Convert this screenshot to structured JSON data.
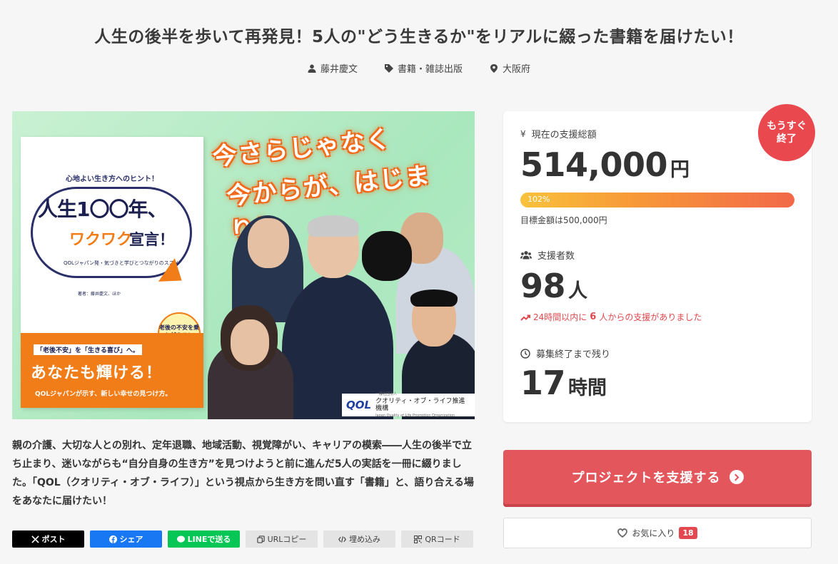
{
  "project": {
    "title": "人生の後半を歩いて再発見！5人の\"どう生きるか\"をリアルに綴った書籍を届けたい！",
    "owner": "藤井慶文",
    "category": "書籍・雑誌出版",
    "location": "大阪府",
    "description": "親の介護、大切な人との別れ、定年退職、地域活動、視覚障がい、キャリアの模索――人生の後半で立ち止まり、迷いながらも“自分自身の生き方”を見つけようと前に進んだ5人の実話を一冊に綴りました。「QOL（クオリティ・オブ・ライフ）」という視点から生き方を問い直す「書籍」と、語り合える場をあなたに届けたい！"
  },
  "hero_image": {
    "catch_line1": "今さらじゃなく",
    "catch_line2": "今からが、はじまり！",
    "book_hint": "心地よい生き方へのヒント！",
    "book_title1": "人生1〇〇年、",
    "book_title2": "ワクワク",
    "book_title3": "宣言！",
    "book_sub": "QOLジャパン発・気づきと学びとつながりのススメ",
    "book_author": "著者：藤井慶文、ほか",
    "book_badge": "老後の不安を乗り越える！",
    "book_band1": "「老後不安」を「生きる喜び」へ。",
    "book_band2": "あなたも輝ける！",
    "book_band3": "QOLジャパンが示す、新しい幸せの見つけ方。",
    "org_logo": "QOL",
    "org_type": "一般社団法人",
    "org_name": "クオリティ・オブ・ライフ推進機構",
    "org_en": "Japan Quality of Life Promotion Organization"
  },
  "stats": {
    "ending_badge_line1": "もうすぐ",
    "ending_badge_line2": "終了",
    "amount_label": "現在の支援総額",
    "amount_value": "514,000",
    "amount_unit": "円",
    "progress_label": "102%",
    "progress_percent": 102,
    "goal_text": "目標金額は500,000円",
    "supporters_label": "支援者数",
    "supporters_value": "98",
    "supporters_unit": "人",
    "trend_pre": "24時間以内に",
    "trend_num": "6",
    "trend_post": "人からの支援がありました",
    "remaining_label": "募集終了まで残り",
    "remaining_value": "17",
    "remaining_unit": "時間"
  },
  "actions": {
    "support_label": "プロジェクトを支援する",
    "favorite_label": "お気に入り",
    "favorite_count": "18"
  },
  "share": {
    "x": "ポスト",
    "facebook": "シェア",
    "line": "LINEで送る",
    "url": "URLコピー",
    "embed": "埋め込み",
    "qr": "QRコード"
  },
  "colors": {
    "accent": "#e3565b",
    "trend": "#e0484e",
    "x_bg": "#000000",
    "facebook_bg": "#1877f2",
    "line_bg": "#06c755"
  }
}
